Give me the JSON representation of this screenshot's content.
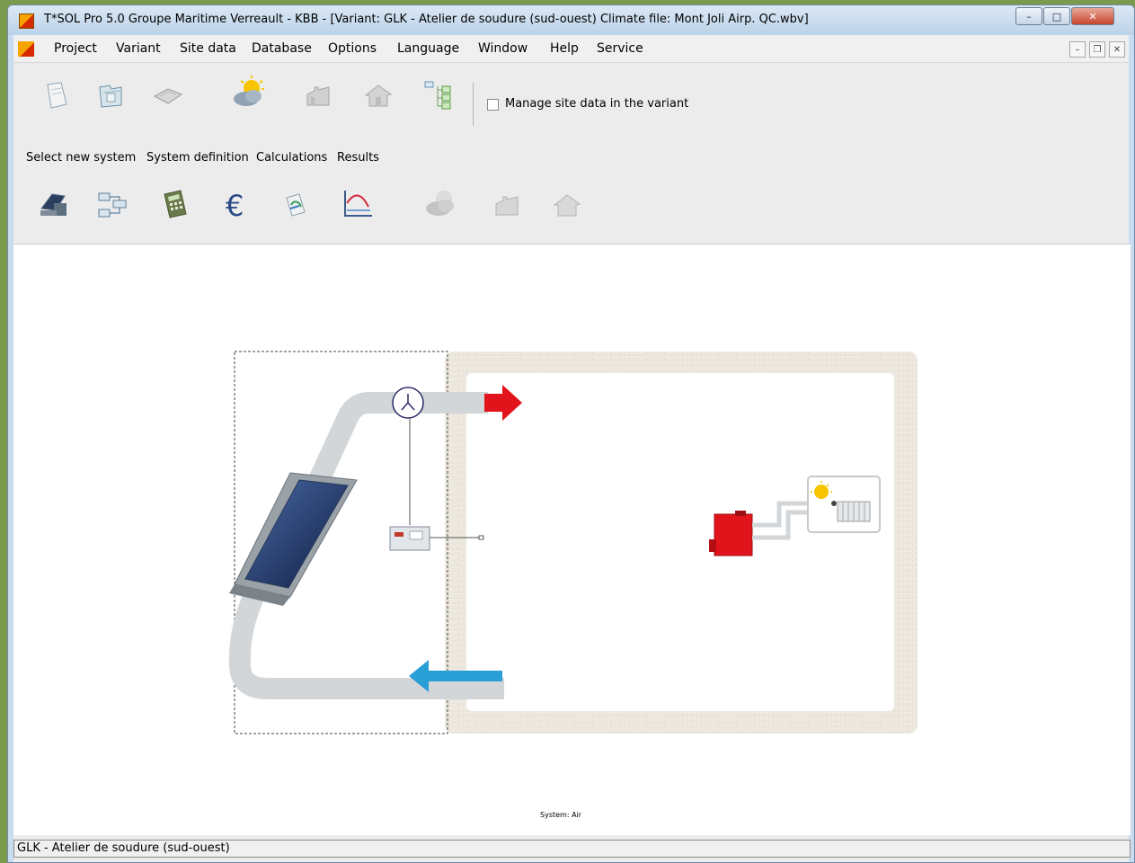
{
  "window": {
    "title": "T*SOL Pro 5.0 Groupe Maritime Verreault - KBB - [Variant: GLK - Atelier de soudure (sud-ouest)    Climate file: Mont Joli Airp. QC.wbv]",
    "controls": {
      "minimize": "–",
      "maximize": "□",
      "close": "✕"
    }
  },
  "menubar": {
    "items": [
      {
        "label": "Project",
        "key": "P"
      },
      {
        "label": "Variant",
        "key": "V"
      },
      {
        "label": "Site data",
        "key": "i"
      },
      {
        "label": "Database",
        "key": "D"
      },
      {
        "label": "Options",
        "key": "O"
      },
      {
        "label": "Language",
        "key": "L"
      },
      {
        "label": "Window",
        "key": "W"
      },
      {
        "label": "Help",
        "key": "H"
      },
      {
        "label": "Service",
        "key": "e"
      }
    ],
    "mdi_controls": {
      "minimize": "–",
      "restore": "❐",
      "close": "✕"
    }
  },
  "toolbar": {
    "row1_icons": [
      "new-project-icon",
      "open-project-icon",
      "save-project-icon",
      "climate-data-icon",
      "factory-icon",
      "house-icon",
      "site-data-tree-icon"
    ],
    "manage_site_data_label": "Manage site data in the variant",
    "manage_site_data_checked": false,
    "tabs": [
      {
        "label": "Select new system",
        "key": "S"
      },
      {
        "label": "System definition",
        "key": "y"
      },
      {
        "label": "Calculations",
        "key": "C"
      },
      {
        "label": "Results",
        "key": "R"
      }
    ],
    "row2_icons": [
      "collector-system-icon",
      "system-definition-icon",
      "calculator-icon",
      "euro-icon",
      "report-icon",
      "chart-axes-icon",
      "climate-disabled-icon",
      "factory-disabled-icon",
      "house-disabled-icon"
    ]
  },
  "canvas": {
    "caption": "System: Air",
    "colors": {
      "hot_arrow": "#e2141b",
      "cold_arrow": "#2a9fd6",
      "boiler": "#e2141b",
      "duct": "#d3d6d8"
    }
  },
  "statusbar": {
    "text": "GLK - Atelier de soudure (sud-ouest)"
  }
}
